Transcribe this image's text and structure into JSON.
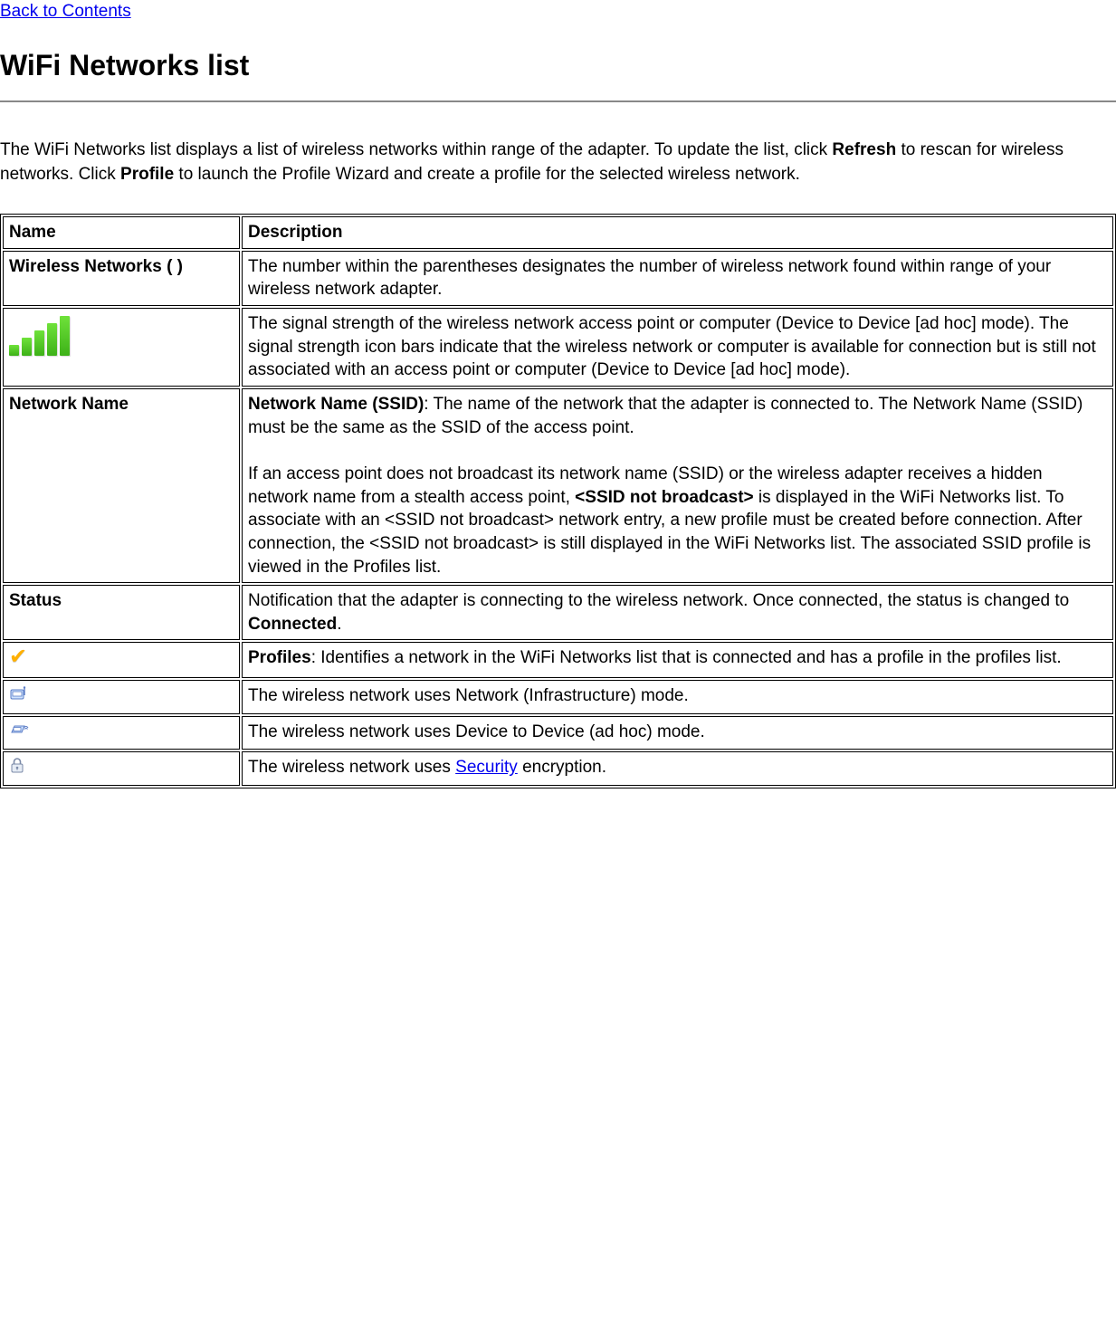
{
  "back_link_label": "Back to Contents",
  "page_title": "WiFi Networks list",
  "intro": {
    "line1_a": "The WiFi Networks list displays a list of wireless networks within range of the adapter. To update the list, click ",
    "refresh_bold": "Refresh",
    "line1_b": " to rescan for wireless networks. Click ",
    "profile_bold": "Profile",
    "line1_c": " to launch the Profile Wizard and create a profile for the selected wireless network."
  },
  "table": {
    "header": {
      "name": "Name",
      "description": "Description"
    },
    "row_wireless_networks": {
      "name": "Wireless Networks ( )",
      "desc": "The number within the parentheses designates the number of wireless network found within range of your wireless network adapter."
    },
    "row_signal": {
      "desc": "The signal strength of the wireless network access point or computer (Device to Device [ad hoc] mode). The signal strength icon bars indicate that the wireless network or computer is available for connection but is still not associated with an access point or computer (Device to Device [ad hoc] mode)."
    },
    "row_network_name": {
      "name": "Network Name",
      "desc_bold": "Network Name (SSID)",
      "desc_a": ": The name of the network that the adapter is connected to. The Network Name (SSID) must be the same as the SSID of the access point.",
      "desc_b_pre": "If an access point does not broadcast its network name (SSID) or the wireless adapter receives a hidden network name from a stealth access point, ",
      "desc_b_bold": "<SSID not broadcast>",
      "desc_b_post": " is displayed in the WiFi Networks list. To associate with an <SSID not broadcast> network entry, a new profile must be created before connection. After connection, the <SSID not broadcast> is still displayed in the WiFi Networks list. The associated SSID profile is viewed in the Profiles list."
    },
    "row_status": {
      "name": "Status",
      "desc_a": "Notification that the adapter is connecting to the wireless network. Once connected, the status is changed to ",
      "desc_bold": "Connected",
      "desc_b": "."
    },
    "row_profiles": {
      "desc_bold": "Profiles",
      "desc": ": Identifies a network in the WiFi Networks list that is connected and has a profile in the profiles list."
    },
    "row_infra": {
      "desc": "The wireless network uses Network (Infrastructure) mode."
    },
    "row_adhoc": {
      "desc": "The wireless network uses Device to Device (ad hoc) mode."
    },
    "row_security": {
      "desc_a": "The wireless network uses ",
      "link": "Security",
      "desc_b": " encryption."
    }
  }
}
